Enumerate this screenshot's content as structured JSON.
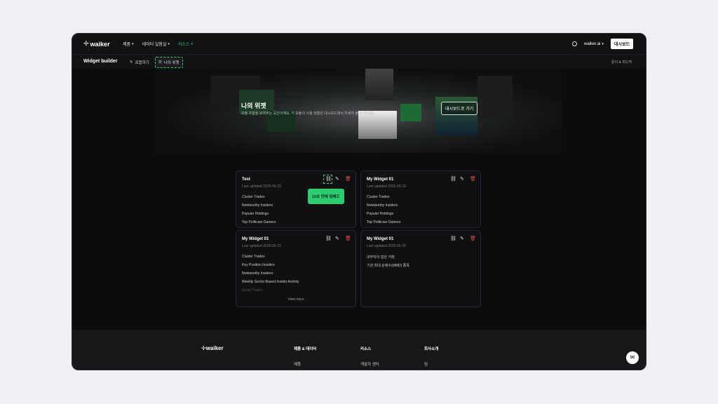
{
  "nav": {
    "logo": "waiker",
    "items": [
      {
        "label": "제품"
      },
      {
        "label": "데이터 실험실"
      },
      {
        "label": "리소스"
      }
    ],
    "account": "waiker.ai",
    "dashboard_btn": "대시보드"
  },
  "subbar": {
    "title": "Widget builder",
    "tabs": [
      {
        "label": "조합하기"
      },
      {
        "label": "나의 위젯"
      }
    ],
    "right": "문의 & 피드백"
  },
  "hero": {
    "title": "나의 위젯",
    "desc": "모듈 조합을 보여주는 공간이에요. 각 모듈의 사용 현황은 대시보드에서 자세히 볼 수 있어요.",
    "button": "대시보드로 가기"
  },
  "cards": [
    {
      "title": "Test",
      "date": "Last updated 2025-06-23",
      "items": [
        "Cluster Trades",
        "Noteworthy Insiders",
        "Popular Holdings",
        "Top Politician Gainers"
      ]
    },
    {
      "title": "My Widget 01",
      "date": "Last updated 2025-06-23",
      "items": [
        "Cluster Trades",
        "Noteworthy Insiders",
        "Popular Holdings",
        "Top Politician Gainers"
      ]
    },
    {
      "title": "My Widget 01",
      "date": "Last updated 2025-06-23",
      "items": [
        "Cluster Trades",
        "Key Position Insiders",
        "Noteworthy Insiders",
        "Weekly Sector-Based Insider Activity",
        "Serial Trades"
      ],
      "view_more": "View more"
    },
    {
      "title": "My Widget 01",
      "date": "Last updated 2025-06-20",
      "items": [
        "내부자의 집단 거래",
        "기관 최대 순매수(MMD) 종목"
      ]
    }
  ],
  "tooltip": "10초 만에 임베드",
  "footer": {
    "logo": "waiker",
    "cols": [
      {
        "heading": "제품 & 데이터",
        "link": "제품"
      },
      {
        "heading": "리소스",
        "link": "개발자 센터"
      },
      {
        "heading": "회사소개",
        "link": "팀"
      }
    ]
  },
  "icons": {
    "link": "link-icon",
    "edit": "edit-icon",
    "delete": "trash-icon",
    "chat": "chat-icon"
  }
}
